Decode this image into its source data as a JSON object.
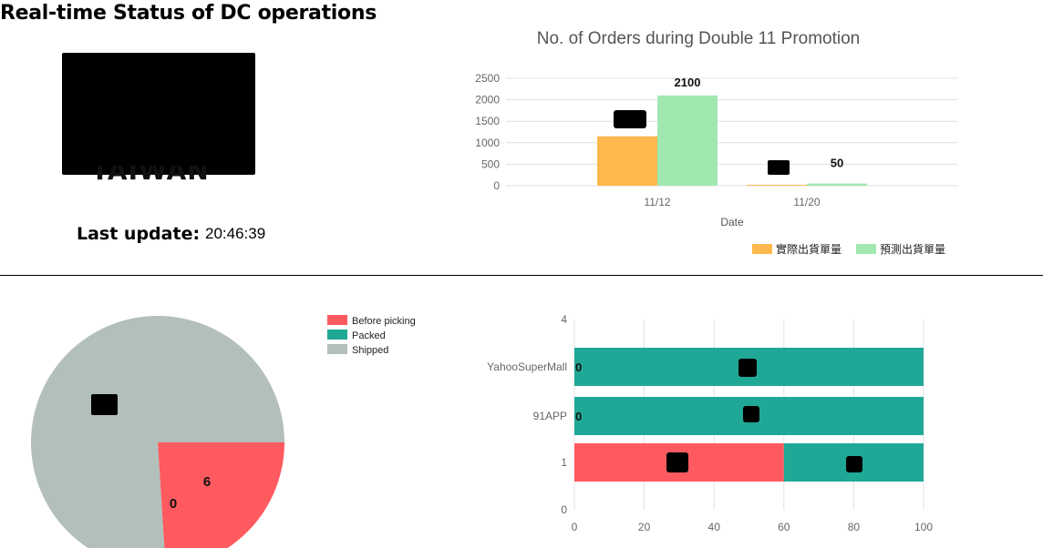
{
  "header": {
    "title": "Real-time Status of DC operations",
    "logo_text": "TAIWAN",
    "last_update_label": "Last update:",
    "last_update_time": "20:46:39"
  },
  "colors": {
    "actual": "#FFB84D",
    "forecast": "#A0E8AF",
    "before_picking": "#FF5A5F",
    "packed": "#20A896",
    "shipped": "#B3BFBA",
    "grid": "#E0E0E0",
    "axis_text": "#666666"
  },
  "chart_data": [
    {
      "type": "bar",
      "title": "No. of Orders during Double 11 Promotion",
      "xlabel": "Date",
      "ylabel": "",
      "categories": [
        "11/12",
        "11/20"
      ],
      "ylim": [
        0,
        2500
      ],
      "yticks": [
        0,
        500,
        1000,
        1500,
        2000,
        2500
      ],
      "series": [
        {
          "name": "實際出貨單量",
          "values": [
            1150,
            20
          ],
          "labels": [
            "",
            ""
          ]
        },
        {
          "name": "預測出貨單量",
          "values": [
            2100,
            50
          ],
          "labels": [
            "2100",
            "50"
          ]
        }
      ],
      "legend": "bottom-right",
      "grid": true
    },
    {
      "type": "pie",
      "legend": "top-right",
      "slices": [
        {
          "name": "Before picking",
          "value": 6,
          "label": "6"
        },
        {
          "name": "Packed",
          "value": 0,
          "label": "0"
        },
        {
          "name": "Shipped",
          "value": 19,
          "label": ""
        }
      ]
    },
    {
      "type": "bar",
      "orientation": "horizontal",
      "stacked": true,
      "categories": [
        "YahooSuperMall",
        "91APP",
        "1"
      ],
      "xlim": [
        0,
        100
      ],
      "xticks": [
        0,
        20,
        40,
        60,
        80,
        100
      ],
      "yticks": [
        "4",
        "YahooSuperMall",
        "91APP",
        "1",
        "0"
      ],
      "series": [
        {
          "name": "Before picking",
          "values": [
            0,
            0,
            60
          ],
          "labels": [
            "0",
            "0",
            ""
          ]
        },
        {
          "name": "Packed",
          "values": [
            100,
            100,
            40
          ],
          "labels": [
            "",
            "",
            ""
          ]
        }
      ],
      "grid": true
    }
  ]
}
